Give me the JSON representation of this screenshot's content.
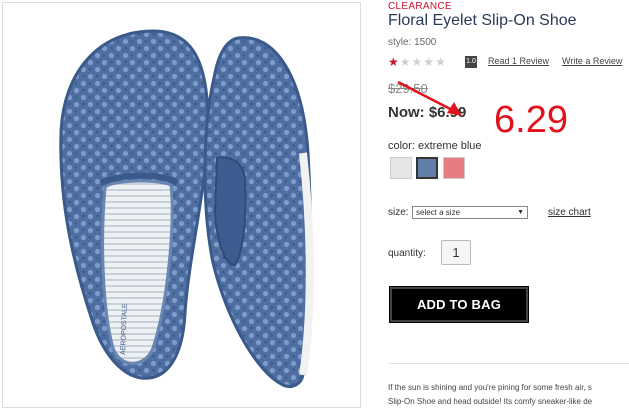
{
  "product": {
    "badge": "CLEARANCE",
    "title": "Floral Eyelet Slip-On Shoe",
    "style": "style: 1500",
    "image_alt": "Blue floral eyelet slip-on shoes",
    "brand_mark": "AEROPOSTALE"
  },
  "rating": {
    "score": "1.0",
    "stars_filled": 1,
    "stars_total": 5,
    "read_link": "Read 1 Review",
    "write_link": "Write a Review"
  },
  "price": {
    "original": "$29.50",
    "now_label": "Now: $6.99"
  },
  "color": {
    "label": "color: extreme blue",
    "swatches": [
      {
        "name": "white",
        "hex": "#e6e6e6",
        "selected": false
      },
      {
        "name": "extreme blue",
        "hex": "#5f7fa8",
        "selected": true
      },
      {
        "name": "coral",
        "hex": "#e77b82",
        "selected": false
      }
    ]
  },
  "size": {
    "label": "size:",
    "placeholder": "select a size",
    "chart_link": "size chart"
  },
  "quantity": {
    "label": "quantity:",
    "value": "1"
  },
  "cart": {
    "add_label": "ADD TO BAG"
  },
  "description": {
    "line1": "If the sun is shining and you're pining for some fresh air, s",
    "line2": "Slip-On Shoe and head outside! Its comfy sneaker-like de"
  },
  "annotation": {
    "value": "6.29",
    "color": "#e0121b"
  },
  "colors": {
    "brand_red": "#c8102e",
    "title_navy": "#2a3a5a",
    "button_black": "#000000"
  }
}
